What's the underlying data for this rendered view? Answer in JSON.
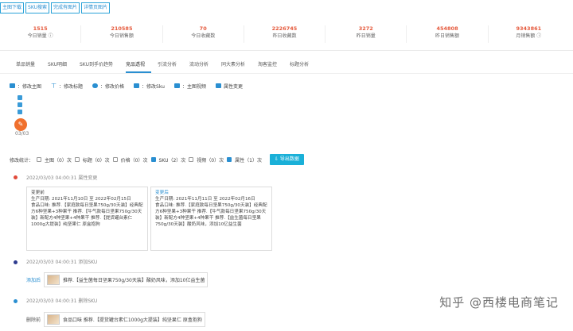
{
  "top_buttons": [
    "主图下载",
    "SKU搜索",
    "完成有图片",
    "详情页图片"
  ],
  "stats": [
    {
      "value": "1515",
      "label": "今日销量 ⓘ"
    },
    {
      "value": "210585",
      "label": "今日销售额"
    },
    {
      "value": "70",
      "label": "今日收藏数"
    },
    {
      "value": "2226745",
      "label": "昨日收藏数"
    },
    {
      "value": "3272",
      "label": "昨日销量"
    },
    {
      "value": "454808",
      "label": "昨日销售额"
    },
    {
      "value": "9343861",
      "label": "月销售额 ⓘ"
    }
  ],
  "tabs": [
    "单品销量",
    "SKU明细",
    "SKU到手价趋势",
    "竞品透视",
    "引流分析",
    "流动分析",
    "同大素分析",
    "淘客监控",
    "标题分析"
  ],
  "active_tab_index": 3,
  "legend": [
    "：修改主图",
    "：修改标题",
    "：修改价格",
    "：修改Sku",
    "：主图视频",
    "属性变更"
  ],
  "legend_colors": [
    "#2a8fd1",
    "#2a8fd1",
    "#2a8fd1",
    "#2a8fd1",
    "#2a8fd1",
    "#2a8fd1"
  ],
  "date_small": "03/03",
  "filter": {
    "label": "修改统计：",
    "items": [
      {
        "text": "主图（0）次",
        "checked": false
      },
      {
        "text": "标题（0）次",
        "checked": false
      },
      {
        "text": "价格（0）次",
        "checked": false
      },
      {
        "text": "SKU（2）次",
        "checked": true
      },
      {
        "text": "视频（0）次",
        "checked": false
      },
      {
        "text": "属性（1）次",
        "checked": true
      }
    ],
    "export_label": "导出数据"
  },
  "events": [
    {
      "time": "2022/03/03 04:00:31 属性变更",
      "color": "#e14b3b"
    },
    {
      "time": "2022/03/03 04:00:31 添加SKU",
      "color": "#2e3c8f"
    },
    {
      "time": "2022/03/03 04:00:31 删除SKU",
      "color": "#2a8fd1"
    }
  ],
  "card_before": {
    "title": "变更前",
    "date": "生产日期: 2021年11月10日 至 2022年02月15日",
    "body": "食品口味: 推荐.【家庭款每日坚果750g/30天装】经典配方6种坚果+3种果干 推荐.【牛气款每日坚果750g/30天装】新配方4种坚果+4种果干 推荐.【提货罐台素仁1000g大提装】纯坚果仁 原盒抱狗"
  },
  "card_after": {
    "title": "变更后",
    "date": "生产日期: 2021年11月11日 至 2022年02月16日",
    "body": "食品口味: 推荐.【家庭款每日坚果750g/30天装】经典配方6种坚果+3种果干 推荐.【牛气款每日坚果750g/30天装】新配方4种坚果+4种果干 推荐.【益生菌每日坚果750g/30天装】酸奶风味，添加10亿益生菌"
  },
  "add_row": {
    "label": "添加后",
    "text": "推荐.【益生菌每日坚果750g/30天装】酸奶风味，添加10亿益生菌"
  },
  "del_row": {
    "label": "删除前",
    "text": "食品口味 推荐.【提货罐台素仁1000g大提装】纯坚果仁 原盒抱狗"
  },
  "watermark": "知乎 @西楼电商笔记"
}
